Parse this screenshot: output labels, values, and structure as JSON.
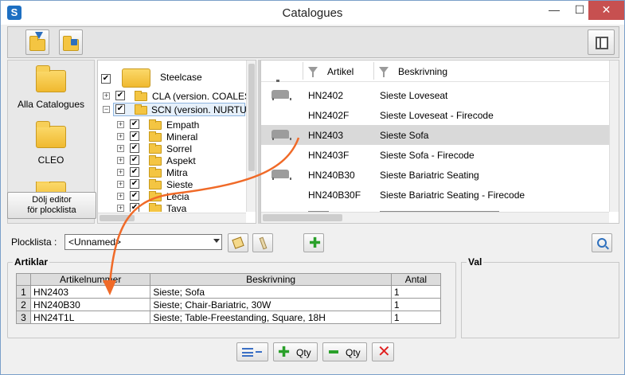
{
  "window": {
    "title": "Catalogues",
    "app_icon_glyph": "S",
    "min_label": "—",
    "max_label": "☐",
    "close_label": "✕"
  },
  "catalogues": [
    {
      "label": "Alla Catalogues"
    },
    {
      "label": "CLEO"
    }
  ],
  "hide_editor_button": {
    "line1": "Dölj editor",
    "line2": "för plocklista"
  },
  "tree": {
    "root": {
      "label": "Steelcase",
      "checked": true
    },
    "nodes": [
      {
        "label": "CLA (version. COALESS",
        "expander": "+",
        "checked": true
      },
      {
        "label": "SCN (version. NURTUR",
        "expander": "−",
        "checked": true,
        "selected": true
      }
    ],
    "children": [
      {
        "label": "Empath"
      },
      {
        "label": "Mineral"
      },
      {
        "label": "Sorrel"
      },
      {
        "label": "Aspekt"
      },
      {
        "label": "Mitra"
      },
      {
        "label": "Sieste"
      },
      {
        "label": "Lecia"
      },
      {
        "label": "Tava"
      }
    ],
    "check_glyph": "✔",
    "expand_glyph": "+"
  },
  "articles": {
    "columns": {
      "artikel": "Artikel",
      "beskrivning": "Beskrivning"
    },
    "rows": [
      {
        "code": "",
        "desc": "",
        "icon": "sofa-icon-partial"
      },
      {
        "code": "HN2402",
        "desc": "Sieste Loveseat",
        "icon": "sofa-icon"
      },
      {
        "code": "HN2402F",
        "desc": "Sieste Loveseat - Firecode",
        "icon": ""
      },
      {
        "code": "HN2403",
        "desc": "Sieste Sofa",
        "icon": "sofa-icon",
        "selected": true
      },
      {
        "code": "HN2403F",
        "desc": "Sieste Sofa - Firecode",
        "icon": ""
      },
      {
        "code": "HN240B30",
        "desc": "Sieste Bariatric Seating",
        "icon": "sofa-icon"
      },
      {
        "code": "HN240B30F",
        "desc": "Sieste Bariatric Seating - Firecode",
        "icon": ""
      }
    ]
  },
  "plocklista": {
    "label": "Plocklista :",
    "value": "<Unnamed>"
  },
  "artiklar": {
    "title": "Artiklar",
    "headers": [
      "Artikelnummer",
      "Beskrivning",
      "Antal"
    ],
    "rows": [
      {
        "num": "1",
        "artikelnummer": "HN2403",
        "beskrivning": "Sieste; Sofa",
        "antal": "1"
      },
      {
        "num": "2",
        "artikelnummer": "HN240B30",
        "beskrivning": "Sieste; Chair-Bariatric, 30W",
        "antal": "1"
      },
      {
        "num": "3",
        "artikelnummer": "HN24T1L",
        "beskrivning": "Sieste; Table-Freestanding, Square, 18H",
        "antal": "1"
      }
    ]
  },
  "val": {
    "title": "Val"
  },
  "bottom_buttons": {
    "add_qty": "Qty",
    "remove_qty": "Qty"
  },
  "colors": {
    "arrow": "#f06a28",
    "close": "#c75050",
    "selection": "#d9d9d9",
    "plus": "#2aa02a",
    "delete": "#e02020"
  }
}
